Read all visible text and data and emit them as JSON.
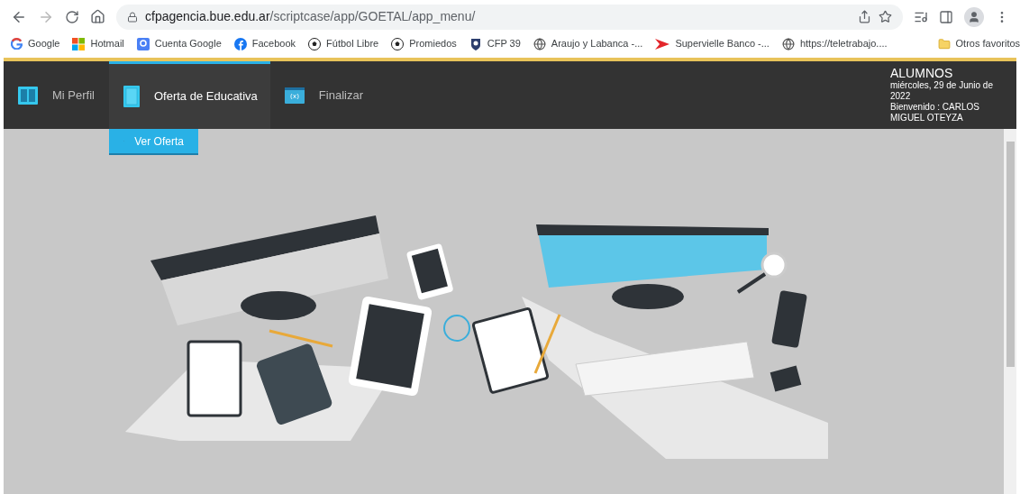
{
  "browser": {
    "url_host": "cfpagencia.bue.edu.ar",
    "url_path": "/scriptcase/app/GOETAL/app_menu/",
    "bookmarks": [
      {
        "label": "Google",
        "kind": "google"
      },
      {
        "label": "Hotmail",
        "kind": "windows"
      },
      {
        "label": "Cuenta Google",
        "kind": "account"
      },
      {
        "label": "Facebook",
        "kind": "facebook"
      },
      {
        "label": "Fútbol Libre",
        "kind": "ball"
      },
      {
        "label": "Promiedos",
        "kind": "ball"
      },
      {
        "label": "CFP 39",
        "kind": "shield"
      },
      {
        "label": "Araujo y Labanca -...",
        "kind": "globe"
      },
      {
        "label": "Supervielle Banco -...",
        "kind": "bank"
      },
      {
        "label": "https://teletrabajo....",
        "kind": "globe"
      }
    ],
    "other_bookmarks": "Otros favoritos"
  },
  "menu": {
    "items": [
      {
        "label": "Mi Perfil",
        "kind": "profile",
        "selected": false
      },
      {
        "label": "Oferta de Educativa",
        "kind": "offer",
        "selected": true
      },
      {
        "label": "Finalizar",
        "kind": "exit",
        "selected": false
      }
    ],
    "submenu": [
      {
        "label": "Ver Oferta"
      }
    ],
    "header": {
      "title": "ALUMNOS",
      "date": "miércoles, 29 de Junio de 2022",
      "welcome": "Bienvenido : CARLOS MIGUEL OTEYZA"
    }
  }
}
